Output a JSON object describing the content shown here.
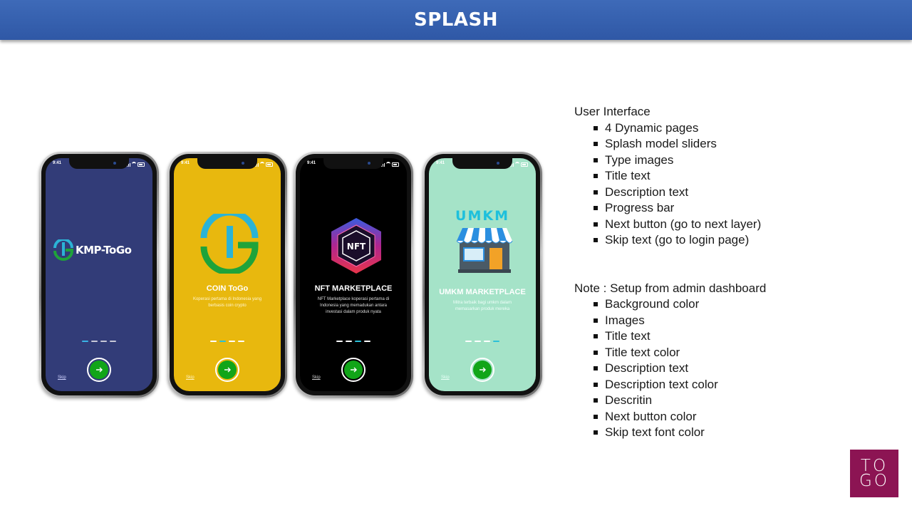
{
  "header": {
    "title": "SPLASH"
  },
  "phones": [
    {
      "bg": "#323c78",
      "text_color": "#ffffff",
      "time": "9:41",
      "logo_text": "KMP-ToGo",
      "title": "",
      "description": "",
      "dots": [
        "#3ab4e6",
        "#c8c8d8",
        "#c8c8d8",
        "#c8c8d8"
      ],
      "skip": "Skip",
      "logo_icon": "tg-logo-icon"
    },
    {
      "bg": "#e8b80e",
      "text_color": "#ffffff",
      "time": "9:41",
      "title": "COIN ToGo",
      "description": "Koperasi pertama di Indonesia yang berbasis coin crypto",
      "dots": [
        "#ffffff",
        "#2bc0d8",
        "#ffffff",
        "#ffffff"
      ],
      "skip": "Skip",
      "logo_icon": "tg-coin-icon"
    },
    {
      "bg": "#000000",
      "text_color": "#ffffff",
      "time": "9:41",
      "title": "NFT MARKETPLACE",
      "description": "NFT Marketplace koperasi pertama di Indonesia yang memadukan antara investasi dalam produk nyata",
      "dots": [
        "#ffffff",
        "#ffffff",
        "#2bc0d8",
        "#ffffff"
      ],
      "skip": "Skip",
      "logo_icon": "nft-hexagon-icon",
      "logo_text": "NFT"
    },
    {
      "bg": "#a5e3c8",
      "text_color": "#ffffff",
      "time": "9:41",
      "title": "UMKM MARKETPLACE",
      "description": "Mitra terbaik bagi umkm dalam memasarkan produk mereka",
      "dots": [
        "#ffffff",
        "#ffffff",
        "#ffffff",
        "#2bc0d8"
      ],
      "skip": "Skip",
      "logo_icon": "umkm-store-icon",
      "logo_text": "UMKM"
    }
  ],
  "spec": {
    "ui_heading": "User Interface",
    "ui_items": [
      "4 Dynamic pages",
      "Splash model sliders",
      "Type images",
      "Title text",
      "Description text",
      "Progress bar",
      "Next button (go to next layer)",
      "Skip text (go to login page)"
    ],
    "note_heading": "Note : Setup from admin dashboard",
    "note_items": [
      "Background color",
      "Images",
      "Title text",
      "Title text color",
      "Description text",
      "Description text color",
      "Descritin",
      "Next button color",
      "Skip text font color"
    ]
  },
  "brand_logo": {
    "line1": "TO",
    "line2": "GO",
    "color": "#8c1453"
  }
}
